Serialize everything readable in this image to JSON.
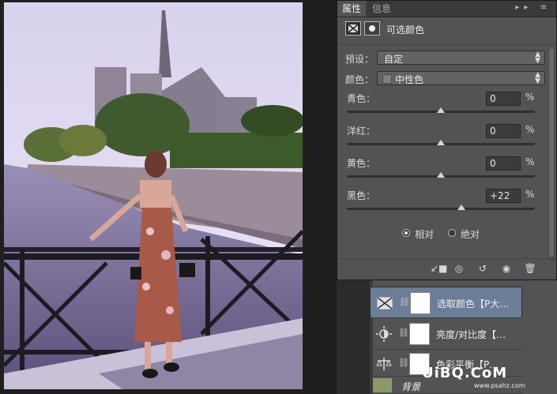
{
  "panel": {
    "tabs": [
      "属性",
      "信息"
    ],
    "header_title": "可选颜色",
    "preset_label": "预设：",
    "preset_value": "自定",
    "colors_label": "颜色：",
    "colors_value": "中性色",
    "sliders": [
      {
        "label": "青色：",
        "value": "0",
        "unit": "%",
        "level": 0.5
      },
      {
        "label": "洋红：",
        "value": "0",
        "unit": "%",
        "level": 0.5
      },
      {
        "label": "黄色：",
        "value": "0",
        "unit": "%",
        "level": 0.5
      },
      {
        "label": "黑色：",
        "value": "+22",
        "unit": "%",
        "level": 0.61
      }
    ],
    "radio_relative": "相对",
    "radio_absolute": "绝对",
    "radio_selected": "relative"
  },
  "layers": [
    {
      "name": "选取颜色【P大…",
      "icon": "selective-color-icon",
      "selected": true
    },
    {
      "name": "亮度/对比度【…",
      "icon": "brightness-contrast-icon",
      "selected": false
    },
    {
      "name": "色彩平衡【P…",
      "icon": "color-balance-icon",
      "selected": false
    },
    {
      "name": "背景",
      "icon": "background-thumbnail",
      "selected": false
    }
  ],
  "watermark": {
    "text": "UiBQ.CoM",
    "sub": "www.psahz.com"
  },
  "colors": {
    "panel_bg": "#535353",
    "selected_layer": "#6b7d97",
    "photo_sky": "#cfc7e6"
  }
}
